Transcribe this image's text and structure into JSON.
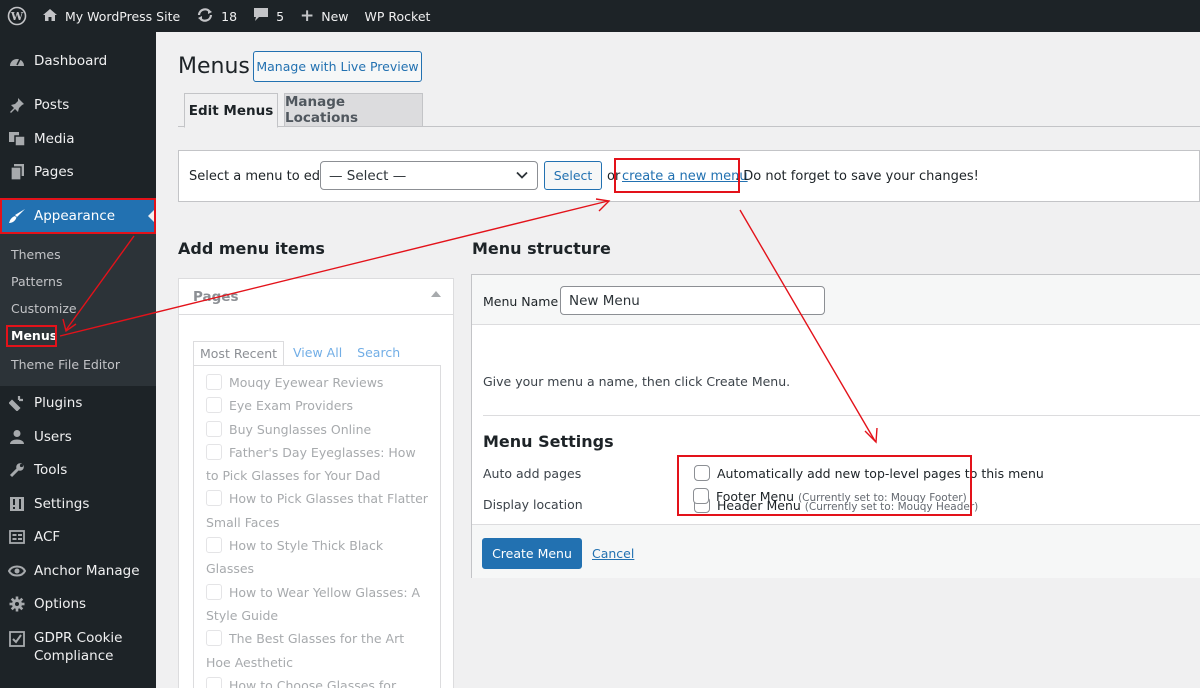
{
  "adminbar": {
    "site_name": "My WordPress Site",
    "updates_count": "18",
    "comments_count": "5",
    "new_label": "New",
    "plugin_label": "WP Rocket",
    "icons": [
      "wordpress-logo-icon",
      "home-icon",
      "updates-icon",
      "comment-icon",
      "plus-icon"
    ]
  },
  "sidebar": {
    "items": [
      {
        "label": "Dashboard",
        "icon": "dashboard-icon"
      },
      {
        "label": "Posts",
        "icon": "pin-icon"
      },
      {
        "label": "Media",
        "icon": "media-icon"
      },
      {
        "label": "Pages",
        "icon": "pages-icon"
      },
      {
        "label": "Appearance",
        "icon": "brush-icon"
      },
      {
        "label": "Plugins",
        "icon": "plugin-icon"
      },
      {
        "label": "Users",
        "icon": "users-icon"
      },
      {
        "label": "Tools",
        "icon": "wrench-icon"
      },
      {
        "label": "Settings",
        "icon": "settings-icon"
      },
      {
        "label": "ACF",
        "icon": "acf-icon"
      },
      {
        "label": "Anchor Manage",
        "icon": "anchor-icon"
      },
      {
        "label": "Options",
        "icon": "gear-icon"
      },
      {
        "label": "GDPR Cookie",
        "label2": "Compliance",
        "icon": "checkbox-icon"
      }
    ],
    "submenu": [
      "Themes",
      "Patterns",
      "Customize",
      "Menus",
      "Theme File Editor"
    ]
  },
  "page": {
    "title": "Menus",
    "live_preview_button": "Manage with Live Preview",
    "tabs": [
      "Edit Menus",
      "Manage Locations"
    ]
  },
  "manage": {
    "select_label": "Select a menu to edit:",
    "select_value": "— Select —",
    "select_button": "Select",
    "or_text": "or",
    "create_link": "create a new menu",
    "after_text": ". Do not forget to save your changes!"
  },
  "add_items": {
    "heading": "Add menu items",
    "panel_title": "Pages",
    "tabs": [
      "Most Recent",
      "View All",
      "Search"
    ],
    "pages": [
      "Mouqy Eyewear Reviews",
      "Eye Exam Providers",
      "Buy Sunglasses Online",
      "Father's Day Eyeglasses: How to Pick Glasses for Your Dad",
      "How to Pick Glasses that Flatter Small Faces",
      "How to Style Thick Black Glasses",
      "How to Wear Yellow Glasses: A Style Guide",
      "The Best Glasses for the Art Hoe Aesthetic",
      "How to Choose Glasses for Fishing"
    ]
  },
  "structure": {
    "heading": "Menu structure",
    "name_label": "Menu Name",
    "name_value": "New Menu",
    "instructions": "Give your menu a name, then click Create Menu.",
    "settings_heading": "Menu Settings",
    "auto_add_label": "Auto add pages",
    "auto_add_option": "Automatically add new top-level pages to this menu",
    "display_location_label": "Display location",
    "locations": [
      {
        "name": "Header Menu",
        "note": "(Currently set to: Mouqy Header)"
      },
      {
        "name": "Footer Menu",
        "note": "(Currently set to: Mouqy Footer)"
      }
    ],
    "create_button": "Create Menu",
    "cancel_link": "Cancel"
  },
  "colors": {
    "admin_dark": "#1d2327",
    "accent": "#2271b1",
    "annotation_red": "#e3121a"
  }
}
